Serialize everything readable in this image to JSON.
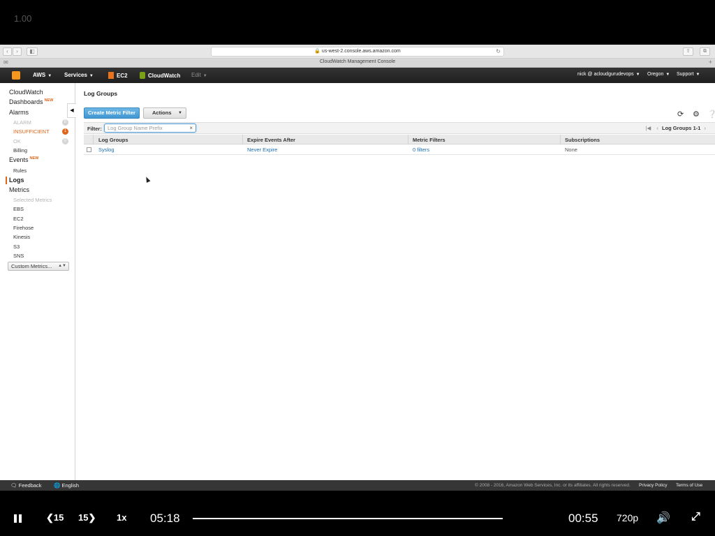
{
  "video": {
    "speed_top": "1.00",
    "speed": "1x",
    "skip_back": "15",
    "skip_forward": "15",
    "elapsed": "05:18",
    "remaining": "00:55",
    "quality": "720p"
  },
  "browser": {
    "url": "us-west-2.console.aws.amazon.com",
    "tab_title": "CloudWatch Management Console"
  },
  "aws_nav": {
    "aws": "AWS",
    "services": "Services",
    "ec2": "EC2",
    "cloudwatch": "CloudWatch",
    "edit": "Edit",
    "user": "nick @ acloudgurudevops",
    "region": "Oregon",
    "support": "Support"
  },
  "sidebar": {
    "cloudwatch": "CloudWatch",
    "dashboards": "Dashboards",
    "new_tag": "NEW",
    "alarms": "Alarms",
    "alarm": "ALARM",
    "alarm_count": "0",
    "insufficient": "INSUFFICIENT",
    "insufficient_count": "1",
    "ok": "OK",
    "ok_count": "0",
    "billing": "Billing",
    "events": "Events",
    "rules": "Rules",
    "logs": "Logs",
    "metrics": "Metrics",
    "selected_metrics": "Selected Metrics",
    "ebs": "EBS",
    "ec2": "EC2",
    "firehose": "Firehose",
    "kinesis": "Kinesis",
    "s3": "S3",
    "sns": "SNS",
    "custom_metrics": "Custom Metrics..."
  },
  "main": {
    "title": "Log Groups",
    "create_button": "Create Metric Filter",
    "actions_button": "Actions",
    "filter_label": "Filter:",
    "filter_placeholder": "Log Group Name Prefix",
    "pager_label": "Log Groups 1-1",
    "columns": [
      "Log Groups",
      "Expire Events After",
      "Metric Filters",
      "Subscriptions"
    ],
    "rows": [
      {
        "name": "Syslog",
        "expire": "Never Expire",
        "filters": "0 filters",
        "subscriptions": "None"
      }
    ]
  },
  "footer": {
    "feedback": "Feedback",
    "language": "English",
    "copyright": "© 2008 - 2016, Amazon Web Services, Inc. or its affiliates. All rights reserved.",
    "privacy": "Privacy Policy",
    "terms": "Terms of Use"
  }
}
